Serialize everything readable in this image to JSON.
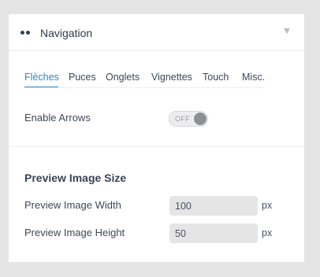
{
  "header": {
    "title": "Navigation",
    "icon": "dots-icon",
    "collapse_icon": "caret-down-icon"
  },
  "tabs": [
    {
      "label": "Flèches",
      "active": true
    },
    {
      "label": "Puces",
      "active": false
    },
    {
      "label": "Onglets",
      "active": false
    },
    {
      "label": "Vignettes",
      "active": false
    },
    {
      "label": "Touch",
      "active": false
    },
    {
      "label": "Misc.",
      "active": false
    }
  ],
  "enable_arrows": {
    "label": "Enable Arrows",
    "toggle_text": "OFF",
    "on": false
  },
  "preview": {
    "section_title": "Preview Image Size",
    "width_label": "Preview Image Width",
    "width_value": "100",
    "width_unit": "px",
    "height_label": "Preview Image Height",
    "height_value": "50",
    "height_unit": "px"
  },
  "colors": {
    "accent": "#2f86c6",
    "text": "#3f4756",
    "background": "#e4e4e4",
    "panel": "#ffffff"
  }
}
